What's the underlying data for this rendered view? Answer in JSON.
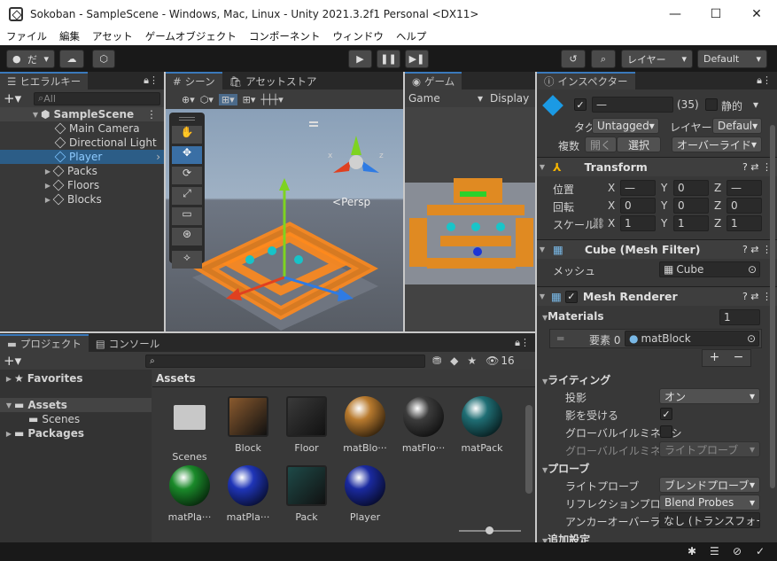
{
  "window": {
    "title": "Sokoban - SampleScene - Windows, Mac, Linux - Unity 2021.3.2f1 Personal <DX11>",
    "minimize": "—",
    "maximize": "☐",
    "close": "✕"
  },
  "menu": [
    "ファイル",
    "編集",
    "アセット",
    "ゲームオブジェクト",
    "コンポーネント",
    "ウィンドウ",
    "ヘルプ"
  ],
  "toolbar": {
    "account": "だ",
    "layers": "レイヤー",
    "layout": "Default"
  },
  "hierarchy": {
    "tab": "ヒエラルキー",
    "search_placeholder": "All",
    "scene": "SampleScene",
    "items": [
      "Main Camera",
      "Directional Light",
      "Player",
      "Packs",
      "Floors",
      "Blocks"
    ]
  },
  "scene": {
    "tab": "シーン",
    "asset_store_tab": "アセットストア",
    "persp": "Persp",
    "axis_x": "x",
    "axis_z": "z",
    "axis_y": "y"
  },
  "game": {
    "tab": "ゲーム",
    "display_dropdown": "Game",
    "display_label": "Display"
  },
  "project": {
    "tab": "プロジェクト",
    "console_tab": "コンソール",
    "hidden_count": "16",
    "favorites": "Favorites",
    "assets": "Assets",
    "scenes": "Scenes",
    "packages": "Packages",
    "breadcrumb": "Assets",
    "items": [
      {
        "name": "Scenes",
        "kind": "folder",
        "color": "#c8c8c8"
      },
      {
        "name": "Block",
        "kind": "cube",
        "color": "#8a5a2e"
      },
      {
        "name": "Floor",
        "kind": "cube",
        "color": "#3a3a3a"
      },
      {
        "name": "matBlo···",
        "kind": "sphere",
        "color": "#b87a2e"
      },
      {
        "name": "matFlo···",
        "kind": "sphere",
        "color": "#3c3c3c"
      },
      {
        "name": "matPack",
        "kind": "sphere",
        "color": "#1f6e74"
      },
      {
        "name": "matPla···",
        "kind": "sphere",
        "color": "#1a8a2a"
      },
      {
        "name": "matPla···",
        "kind": "sphere",
        "color": "#1f35b8"
      },
      {
        "name": "Pack",
        "kind": "cube",
        "color": "#1e4a48"
      },
      {
        "name": "Player",
        "kind": "sphere",
        "color": "#1a2aa0"
      }
    ]
  },
  "inspector": {
    "tab": "インスペクター",
    "object_name": "—",
    "layer_count": "(35)",
    "static_label": "静的",
    "tag_label": "タグ",
    "tag_value": "Untagged",
    "layer_label": "レイヤー",
    "layer_value": "Defaul",
    "multi_label": "複数",
    "open_btn": "開く",
    "select_btn": "選択",
    "override_btn": "オーバーライド",
    "transform": {
      "title": "Transform",
      "position": "位置",
      "rotation": "回転",
      "scale": "スケール",
      "pos": {
        "x": "—",
        "y": "0",
        "z": "—"
      },
      "rot": {
        "x": "0",
        "y": "0",
        "z": "0"
      },
      "scl": {
        "x": "1",
        "y": "1",
        "z": "1"
      }
    },
    "mesh_filter": {
      "title": "Cube (Mesh Filter)",
      "mesh_label": "メッシュ",
      "mesh_value": "Cube"
    },
    "mesh_renderer": {
      "title": "Mesh Renderer",
      "materials": "Materials",
      "materials_count": "1",
      "element_label": "要素 0",
      "element_value": "matBlock",
      "lighting": "ライティング",
      "cast_shadows": "投影",
      "cast_shadows_value": "オン",
      "receive_shadows": "影を受ける",
      "gi1": "グローバルイルミネーシ",
      "gi2": "グローバルイルミネーシ",
      "gi2_value": "ライトプローブ",
      "probes": "プローブ",
      "light_probe": "ライトプローブ",
      "light_probe_value": "ブレンドプローブ",
      "reflection_probe": "リフレクションプローブ",
      "reflection_probe_value": "Blend Probes",
      "anchor": "アンカーオーバーライド",
      "anchor_value": "なし (トランスフォーム",
      "additional": "追加設定"
    }
  }
}
